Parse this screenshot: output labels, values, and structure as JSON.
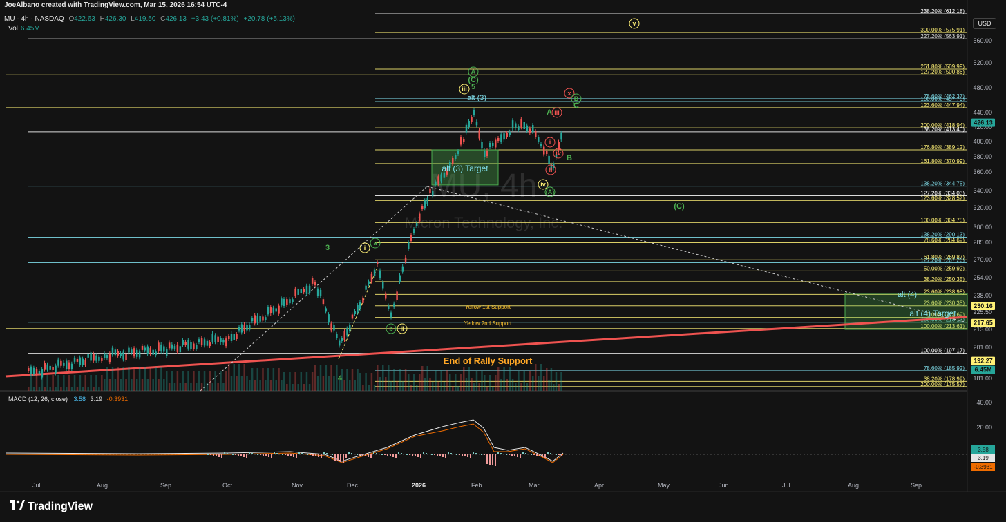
{
  "header": {
    "credit": "JoeAlbano created with TradingView.com, Mar 15, 2026 16:54 UTC-4",
    "symbol": "MU · 4h · NASDAQ",
    "ohlc": {
      "o_label": "O",
      "o": "422.63",
      "h_label": "H",
      "h": "426.30",
      "l_label": "L",
      "l": "419.50",
      "c_label": "C",
      "c": "426.13",
      "change": "+3.43 (+0.81%)",
      "range": "+20.78 (+5.13%)"
    },
    "vol_label": "Vol",
    "vol_value": "6.45M",
    "currency": "USD"
  },
  "watermark": {
    "ticker": "MU, 4h",
    "name": "Micron Technology, Inc."
  },
  "chart_data": {
    "type": "candlestick",
    "price_axis_ticks": [
      560,
      520,
      480,
      440,
      420,
      400,
      380,
      360,
      340,
      320,
      300,
      285,
      270,
      254,
      238,
      225.5,
      213,
      201,
      181
    ],
    "price_ticks_text": [
      "560.00",
      "520.00",
      "480.00",
      "440.00",
      "420.00",
      "400.00",
      "380.00",
      "360.00",
      "340.00",
      "320.00",
      "300.00",
      "285.00",
      "270.00",
      "254.00",
      "238.00",
      "225.50",
      "213.00",
      "201.00",
      "181.00"
    ],
    "x_labels": [
      "Jul",
      "Aug",
      "Sep",
      "Oct",
      "Nov",
      "Dec",
      "2026",
      "Feb",
      "Mar",
      "Apr",
      "May",
      "Jun",
      "Jul",
      "Aug",
      "Sep"
    ],
    "price_badges": [
      {
        "text": "426.13",
        "value": 426.13,
        "color": "#26a69a"
      },
      {
        "text": "230.16",
        "value": 230.16,
        "color": "#fff176"
      },
      {
        "text": "217.65",
        "value": 217.65,
        "color": "#fff176"
      },
      {
        "text": "192.27",
        "value": 192.27,
        "color": "#fff176"
      },
      {
        "text": "6.45M",
        "value": 186.5,
        "color": "#26a69a"
      }
    ],
    "fib_lines": [
      {
        "label": "238.20% (612.18)",
        "value": 612.18,
        "color": "#ffffff"
      },
      {
        "label": "300.00% (575.91)",
        "value": 575.91,
        "color": "#fff176"
      },
      {
        "label": "227.20% (563.91)",
        "value": 563.91,
        "color": "#e0e0e0"
      },
      {
        "label": "261.80% (509.99)",
        "value": 509.99,
        "color": "#fff176"
      },
      {
        "label": "127.20% (500.86)",
        "value": 500.86,
        "color": "#fff176"
      },
      {
        "label": "78.60% (462.37)",
        "value": 462.37,
        "color": "#80deea"
      },
      {
        "label": "100.00% (457.79)",
        "value": 457.79,
        "color": "#80deea"
      },
      {
        "label": "123.60% (447.94)",
        "value": 447.94,
        "color": "#fff176"
      },
      {
        "label": "200.00% (418.94)",
        "value": 418.94,
        "color": "#fff176"
      },
      {
        "label": "138.20% (413.40)",
        "value": 413.4,
        "color": "#ffffff"
      },
      {
        "label": "176.80% (389.12)",
        "value": 389.12,
        "color": "#fff176"
      },
      {
        "label": "161.80% (370.99)",
        "value": 370.99,
        "color": "#fff176"
      },
      {
        "label": "138.20% (344.75)",
        "value": 344.75,
        "color": "#80deea"
      },
      {
        "label": "127.20% (334.03)",
        "value": 334.03,
        "color": "#ffffff"
      },
      {
        "label": "123.60% (328.52)",
        "value": 328.52,
        "color": "#fff176"
      },
      {
        "label": "100.00% (304.75)",
        "value": 304.75,
        "color": "#fff176"
      },
      {
        "label": "138.20% (290.13)",
        "value": 290.13,
        "color": "#80deea"
      },
      {
        "label": "78.60% (284.69)",
        "value": 284.69,
        "color": "#fff176"
      },
      {
        "label": "61.80% (269.87)",
        "value": 269.87,
        "color": "#fff176"
      },
      {
        "label": "127.20% (267.26)",
        "value": 267.26,
        "color": "#80deea"
      },
      {
        "label": "50.00% (259.92)",
        "value": 259.92,
        "color": "#fff176"
      },
      {
        "label": "38.20% (250.35)",
        "value": 250.35,
        "color": "#fff176"
      },
      {
        "label": "23.60% (238.98)",
        "value": 238.98,
        "color": "#fff176"
      },
      {
        "label": "23.60% (230.35)",
        "value": 230.35,
        "color": "#fff176"
      },
      {
        "label": "0.00% (221.69)",
        "value": 221.69,
        "color": "#fff176"
      },
      {
        "label": "100.00% (218.13)",
        "value": 218.13,
        "color": "#80deea"
      },
      {
        "label": "100.00% (213.61)",
        "value": 213.61,
        "color": "#fff176"
      },
      {
        "label": "100.00% (197.17)",
        "value": 197.17,
        "color": "#ffffff"
      },
      {
        "label": "78.60% (185.92)",
        "value": 185.92,
        "color": "#80deea"
      },
      {
        "label": "38.20% (178.99)",
        "value": 178.99,
        "color": "#fff176"
      },
      {
        "label": "200.00% (175.57)",
        "value": 175.57,
        "color": "#fff176"
      }
    ],
    "annotations": [
      {
        "text": "alt (3)",
        "color": "#80deea"
      },
      {
        "text": "alt (3) Target",
        "color": "#80deea"
      },
      {
        "text": "alt (4)",
        "color": "#80deea"
      },
      {
        "text": "alt (4) Target",
        "color": "#80deea"
      },
      {
        "text": "Yellow 1st Support",
        "color": "#fbc02d"
      },
      {
        "text": "Yellow 2nd Support",
        "color": "#fbc02d"
      },
      {
        "text": "End of Rally Support",
        "color": "#ffa726"
      }
    ],
    "wave_labels": [
      "v",
      "A",
      "(C)",
      "5",
      "iii",
      "x",
      "B",
      "C",
      "iii",
      "A",
      "i",
      "iv",
      "B",
      "ii",
      "iv",
      "(A)",
      "(C)",
      "3",
      "i",
      "a",
      "b",
      "ii",
      "4"
    ],
    "macd": {
      "label": "MACD (12, 26, close)",
      "values": [
        "3.58",
        "3.19",
        "-0.3931"
      ],
      "axis_ticks": [
        "40.00",
        "20.00",
        "0"
      ],
      "badges": [
        "3.58",
        "3.19",
        "-0.3931"
      ]
    }
  },
  "footer": {
    "brand": "TradingView"
  }
}
